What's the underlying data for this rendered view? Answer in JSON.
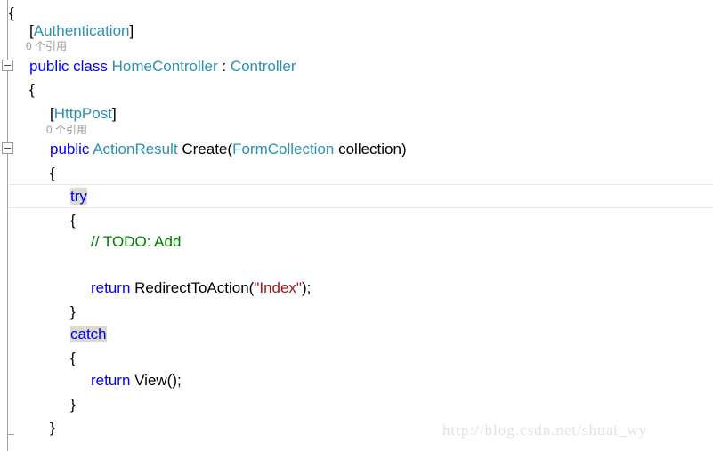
{
  "editor": {
    "language": "csharp",
    "theme": "visual-studio-light",
    "background": "#ffffff",
    "colors": {
      "keyword": "#0000ff",
      "type": "#2b91af",
      "string": "#a31515",
      "comment": "#008000",
      "plain": "#000000",
      "reference_highlight": "#dcdcc8",
      "current_line_border": "#e6e6ee",
      "gutter_line": "#a0a0a0",
      "codelens_text": "#9a9a9a",
      "watermark": "#e2e2de"
    }
  },
  "gutter": {
    "collapse_markers": [
      {
        "glyph": "minus",
        "label": "collapse-class-region"
      },
      {
        "glyph": "minus",
        "label": "collapse-method-region"
      }
    ]
  },
  "codelens": [
    {
      "text": "0 个引用"
    },
    {
      "text": "0 个引用"
    }
  ],
  "code_lines": [
    {
      "indent": "",
      "tokens": [
        {
          "t": "{",
          "c": "pln"
        }
      ]
    },
    {
      "indent": "    ",
      "tokens": [
        {
          "t": "[",
          "c": "pln"
        },
        {
          "t": "Authentication",
          "c": "type"
        },
        {
          "t": "]",
          "c": "pln"
        }
      ]
    },
    {
      "indent": "    ",
      "tokens": [
        {
          "t": "public class ",
          "c": "kw"
        },
        {
          "t": "HomeController",
          "c": "type"
        },
        {
          "t": " : ",
          "c": "pln"
        },
        {
          "t": "Controller",
          "c": "type"
        }
      ]
    },
    {
      "indent": "    ",
      "tokens": [
        {
          "t": "{",
          "c": "pln"
        }
      ]
    },
    {
      "indent": "        ",
      "tokens": [
        {
          "t": "[",
          "c": "pln"
        },
        {
          "t": "HttpPost",
          "c": "type"
        },
        {
          "t": "]",
          "c": "pln"
        }
      ]
    },
    {
      "indent": "        ",
      "tokens": [
        {
          "t": "public ",
          "c": "kw"
        },
        {
          "t": "ActionResult",
          "c": "type"
        },
        {
          "t": " Create(",
          "c": "pln"
        },
        {
          "t": "FormCollection",
          "c": "type"
        },
        {
          "t": " collection)",
          "c": "pln"
        }
      ]
    },
    {
      "indent": "        ",
      "tokens": [
        {
          "t": "{",
          "c": "pln"
        }
      ]
    },
    {
      "indent": "            ",
      "tokens": [
        {
          "t": "try",
          "c": "kw",
          "hl": true
        }
      ]
    },
    {
      "indent": "            ",
      "tokens": [
        {
          "t": "{",
          "c": "pln"
        }
      ]
    },
    {
      "indent": "                ",
      "tokens": [
        {
          "t": "// TODO: Add",
          "c": "com"
        }
      ]
    },
    {
      "indent": "",
      "tokens": []
    },
    {
      "indent": "                ",
      "tokens": [
        {
          "t": "return ",
          "c": "kw"
        },
        {
          "t": "RedirectToAction(",
          "c": "pln"
        },
        {
          "t": "\"Index\"",
          "c": "str"
        },
        {
          "t": ");",
          "c": "pln"
        }
      ]
    },
    {
      "indent": "            ",
      "tokens": [
        {
          "t": "}",
          "c": "pln"
        }
      ]
    },
    {
      "indent": "            ",
      "tokens": [
        {
          "t": "catch",
          "c": "kw",
          "hl": true
        }
      ]
    },
    {
      "indent": "            ",
      "tokens": [
        {
          "t": "{",
          "c": "pln"
        }
      ]
    },
    {
      "indent": "                ",
      "tokens": [
        {
          "t": "return ",
          "c": "kw"
        },
        {
          "t": "View();",
          "c": "pln"
        }
      ]
    },
    {
      "indent": "            ",
      "tokens": [
        {
          "t": "}",
          "c": "pln"
        }
      ]
    },
    {
      "indent": "        ",
      "tokens": [
        {
          "t": "}",
          "c": "pln"
        }
      ]
    }
  ],
  "current_line_index": 7,
  "watermark": {
    "text": "http://blog.csdn.net/shuai_wy"
  }
}
